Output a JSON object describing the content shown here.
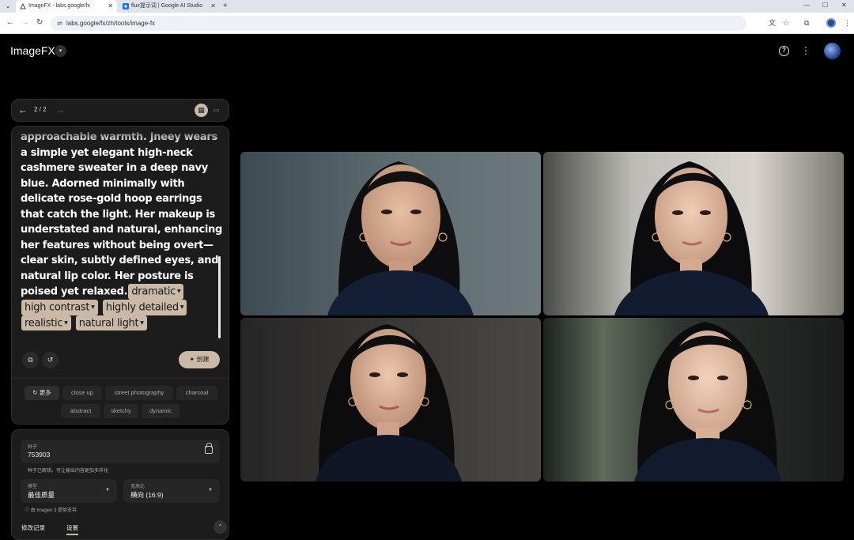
{
  "browser": {
    "tabs": [
      {
        "title": "ImageFX - labs.google/fx",
        "active": true
      },
      {
        "title": "flux提示词 | Google AI Studio",
        "active": false
      }
    ],
    "url": "labs.google/fx/zh/tools/image-fx"
  },
  "app": {
    "title": "ImageFX"
  },
  "pager": {
    "count": "2 / 2"
  },
  "prompt": {
    "text": "approachable warmth. Jneey wears a simple yet elegant high-neck cashmere sweater in a deep navy blue. Adorned minimally with delicate rose-gold hoop earrings that catch the light. Her makeup is understated and natural, enhancing her features without being overt—clear skin, subtly defined eyes, and natural lip color. Her posture is poised yet relaxed.",
    "chips": [
      "dramatic",
      "high contrast",
      "highly detailed",
      "realistic",
      "natural light"
    ],
    "create_label": "创建"
  },
  "suggestions": {
    "more_label": "更多",
    "items": [
      "close up",
      "street photography",
      "charcoal",
      "abstract",
      "sketchy",
      "dynamic"
    ]
  },
  "settings": {
    "seed_label": "种子",
    "seed_value": "753903",
    "seed_note": "种子已解锁。可让输出内容更加多样化",
    "model_label": "模型",
    "model_value": "最佳质量",
    "aspect_label": "宽高比",
    "aspect_value": "横向 (16:9)",
    "powered_by": "由 Imagen 3 提供支持",
    "tab_history": "修改记录",
    "tab_settings": "设置"
  },
  "images": [
    {
      "alt": "portrait-1"
    },
    {
      "alt": "portrait-2"
    },
    {
      "alt": "portrait-3"
    },
    {
      "alt": "portrait-4"
    }
  ],
  "colors": {
    "accent": "#c9b9a6",
    "panel": "#1c1c1c",
    "sweater": "#14203a"
  }
}
